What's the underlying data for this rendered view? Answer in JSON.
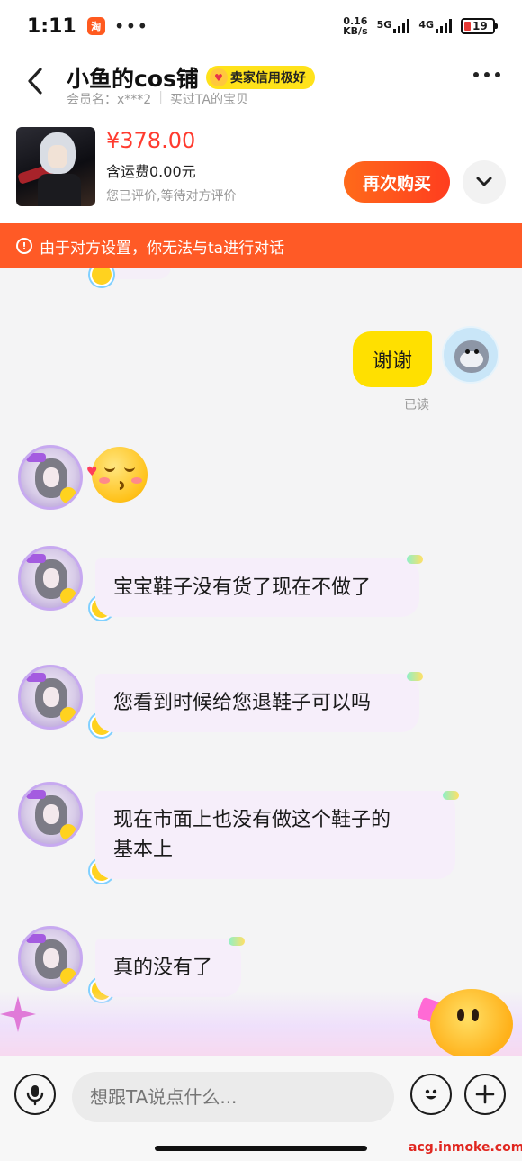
{
  "status_bar": {
    "time": "1:11",
    "net_speed_value": "0.16",
    "net_speed_unit": "KB/s",
    "signal_1": "5G",
    "signal_2": "4G",
    "battery": "19"
  },
  "header": {
    "shop_name": "小鱼的cos铺",
    "seller_badge": "卖家信用极好",
    "member_label": "会员名：x***2",
    "purchased_label": "买过TA的宝贝"
  },
  "product": {
    "price": "¥378.00",
    "shipping": "含运费0.00元",
    "review_status": "您已评价,等待对方评价",
    "rebuy_label": "再次购买"
  },
  "warning": {
    "text": "由于对方设置，你无法与ta进行对话"
  },
  "messages": {
    "outgoing_text": "谢谢",
    "read_status": "已读",
    "incoming": [
      {
        "text": "宝宝鞋子没有货了现在不做了"
      },
      {
        "text": "您看到时候给您退鞋子可以吗"
      },
      {
        "line1": "现在市面上也没有做这个鞋子的",
        "line2": "基本上"
      },
      {
        "text": "真的没有了"
      }
    ]
  },
  "input_bar": {
    "placeholder": "想跟TA说点什么..."
  },
  "watermark": "acg.inmoke.com",
  "colors": {
    "accent": "#ff5a26",
    "price": "#ff3b2f",
    "outgoing_bubble": "#ffe000",
    "incoming_bubble": "#f6eefa",
    "badge": "#ffe21a"
  },
  "icons": [
    "back-arrow-icon",
    "more-icon",
    "chevron-down-icon",
    "warning-icon",
    "microphone-icon",
    "smiley-icon",
    "plus-icon"
  ]
}
